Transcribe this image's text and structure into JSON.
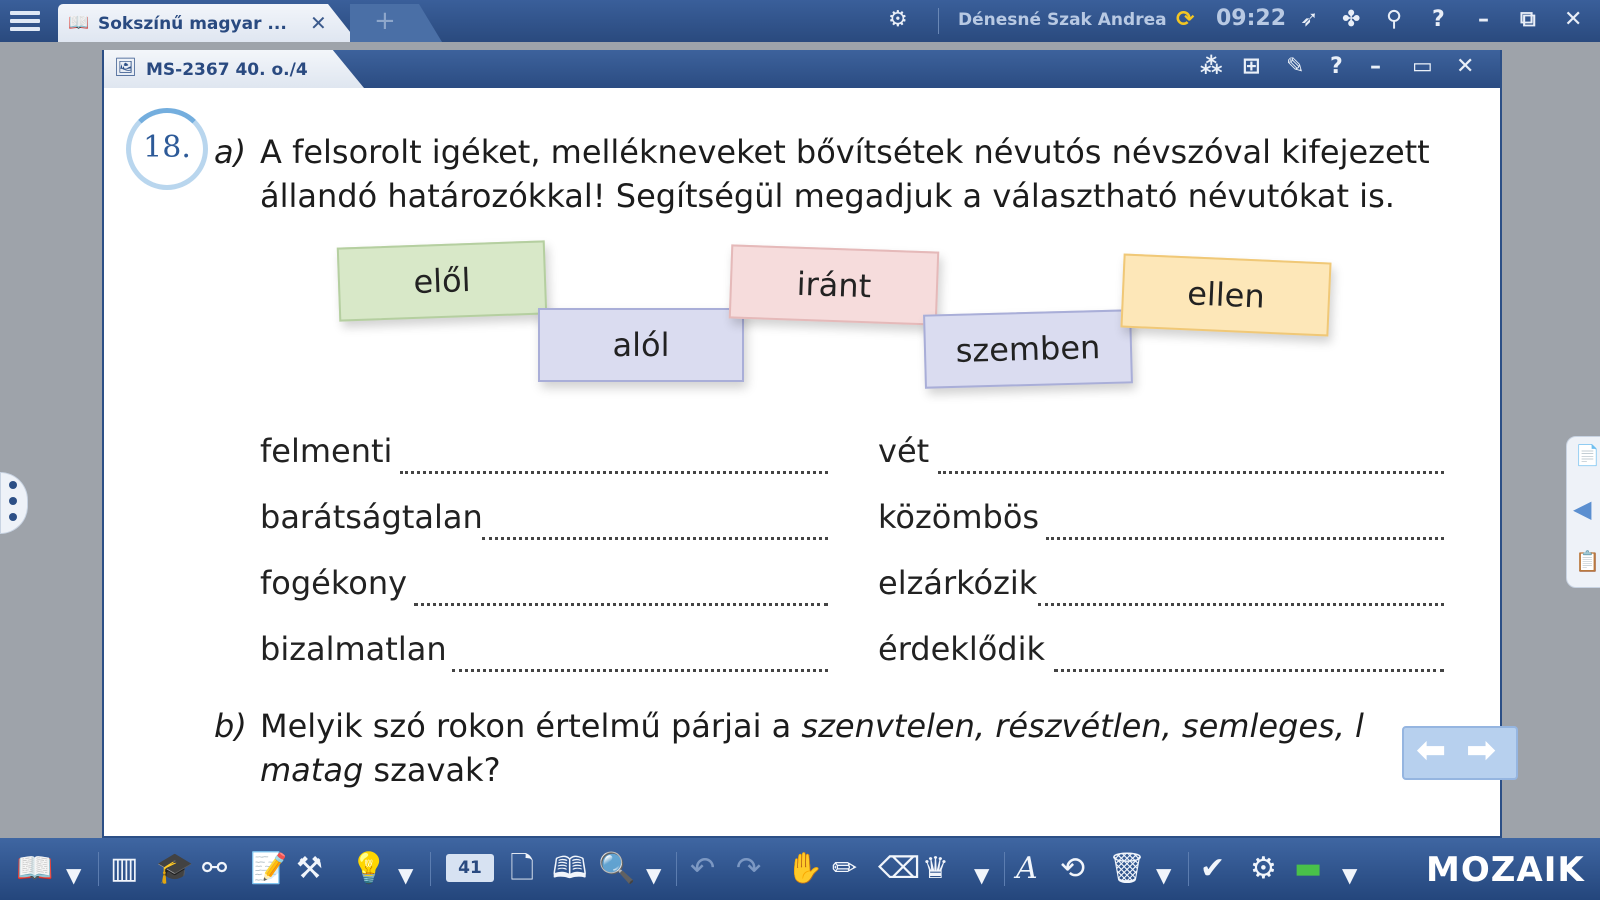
{
  "app": {
    "tab_title": "Sokszínű magyar ...",
    "tab_close": "✕",
    "new_tab": "+",
    "user_name": "Dénesné Szak Andrea",
    "time": "09:22",
    "top_icons": [
      "settings-icon",
      "refresh-icon",
      "rocket-icon",
      "apps-icon",
      "search-icon",
      "help-icon",
      "minimize-icon",
      "popout-icon",
      "close-icon"
    ]
  },
  "window": {
    "title": "MS-2367 40. o./4",
    "icons": [
      "share-icon",
      "add-window-icon",
      "pin-icon",
      "help-icon",
      "minimize-icon",
      "maximize-icon",
      "close-icon"
    ]
  },
  "exercise": {
    "number": "18.",
    "part_a_label": "a)",
    "part_a_line1": "A felsorolt igéket, mellékneveket bővítsétek névutós névszóval kifejezett",
    "part_a_line2": "állandó határozókkal! Segítségül megadjuk a választható névutókat is.",
    "cards": [
      {
        "text": "elől",
        "color": "#d8e8c8"
      },
      {
        "text": "alól",
        "color": "#dadcf0"
      },
      {
        "text": "iránt",
        "color": "#f6dcdc"
      },
      {
        "text": "szemben",
        "color": "#dadcf0"
      },
      {
        "text": "ellen",
        "color": "#fde7b8"
      }
    ],
    "left_words": [
      "felmenti",
      "barátságtalan",
      "fogékony",
      "bizalmatlan"
    ],
    "right_words": [
      "vét",
      "közömbös",
      "elzárkózik",
      "érdeklődik"
    ],
    "part_b_label": "b)",
    "part_b_prefix": "Melyik szó rokon értelmű párjai a",
    "part_b_italic": "szenvtelen, részvétlen, semleges, l",
    "part_b_line2_italic": "matag",
    "part_b_line2_rest": "szavak?"
  },
  "nav": {
    "prev": "⬅",
    "next": "➡"
  },
  "bottom": {
    "page_number": "41",
    "logo": "MOZAIK"
  }
}
